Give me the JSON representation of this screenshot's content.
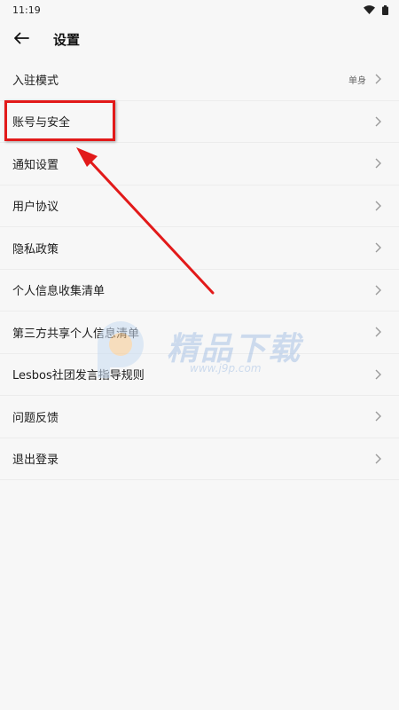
{
  "status_bar": {
    "time": "11:19",
    "icons": [
      "wifi-icon",
      "battery-icon"
    ]
  },
  "header": {
    "back_icon": "arrow-left-icon",
    "title": "设置"
  },
  "settings": {
    "items": [
      {
        "label": "入驻模式",
        "value": "单身"
      },
      {
        "label": "账号与安全",
        "value": ""
      },
      {
        "label": "通知设置",
        "value": ""
      },
      {
        "label": "用户协议",
        "value": ""
      },
      {
        "label": "隐私政策",
        "value": ""
      },
      {
        "label": "个人信息收集清单",
        "value": ""
      },
      {
        "label": "第三方共享个人信息清单",
        "value": ""
      },
      {
        "label": "Lesbos社团发言指导规则",
        "value": ""
      },
      {
        "label": "问题反馈",
        "value": ""
      },
      {
        "label": "退出登录",
        "value": ""
      }
    ]
  },
  "annotation": {
    "color": "#e21a1a",
    "highlighted_item": "账号与安全"
  },
  "watermark": {
    "title": "精品下载",
    "url": "www.j9p.com"
  },
  "colors": {
    "background": "#f7f7f7",
    "divider": "#ececec",
    "chevron": "#9a9a9a",
    "watermark": "#a9c4e6"
  }
}
